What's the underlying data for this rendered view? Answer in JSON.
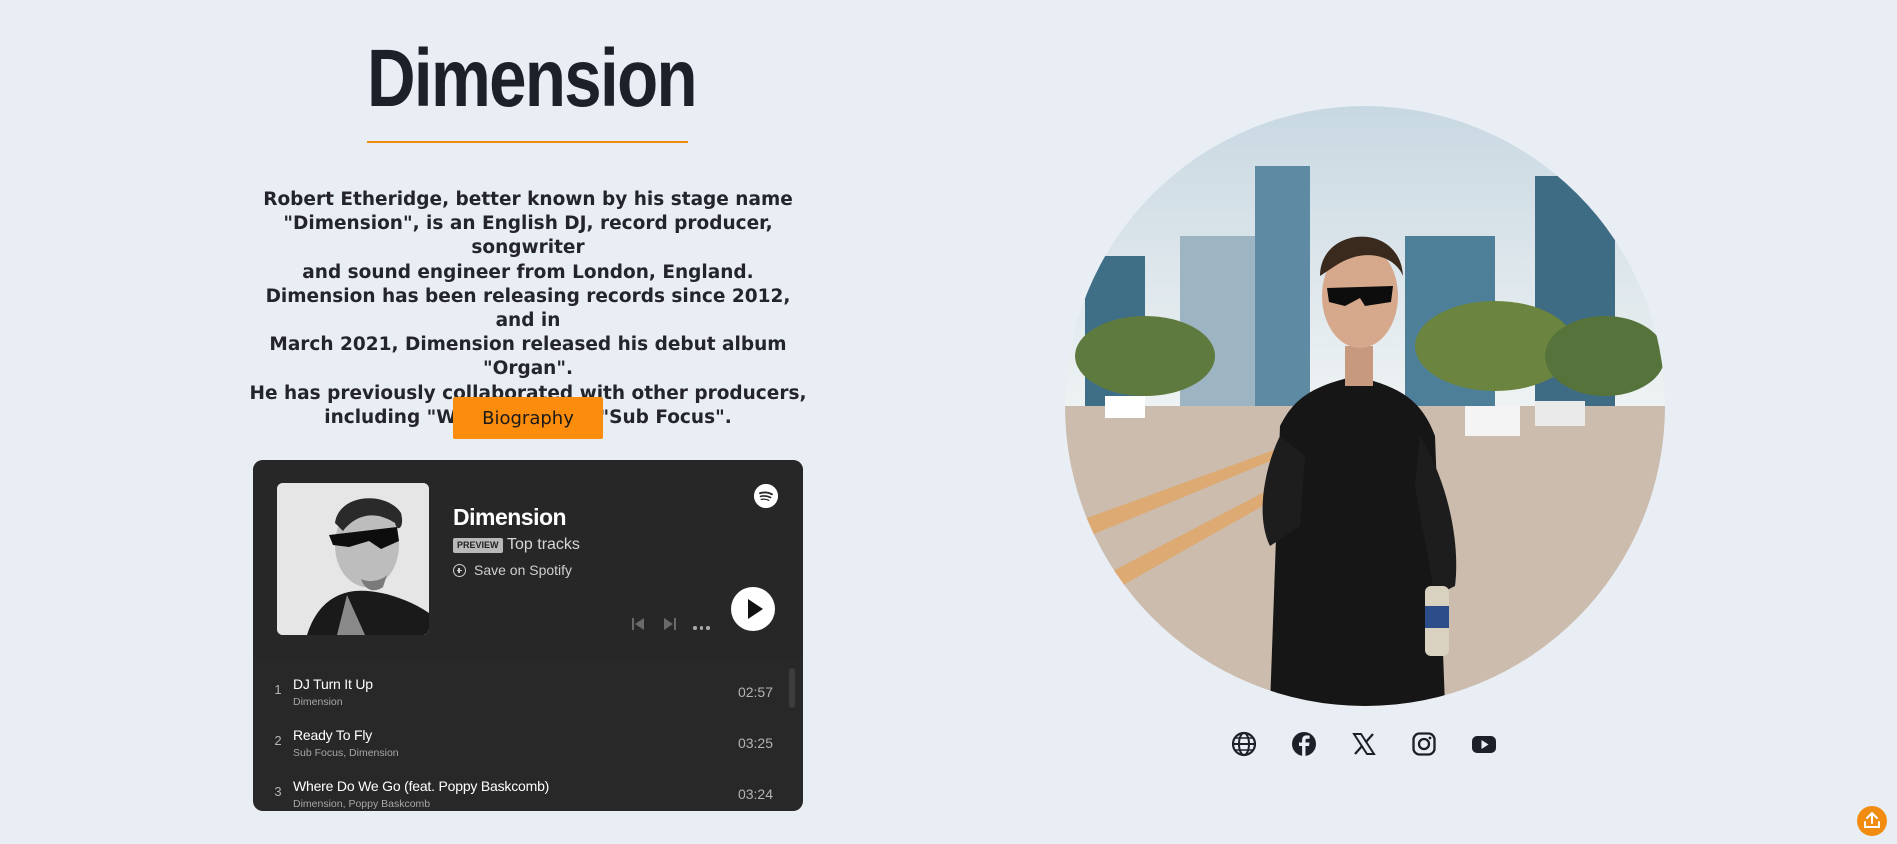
{
  "artist": {
    "name": "Dimension",
    "bio_lines": [
      "Robert Etheridge, better known by his stage name",
      "\"Dimension\", is an English DJ, record producer, songwriter",
      "and sound engineer from London, England.",
      "Dimension has been releasing records since 2012, and in",
      "March 2021, Dimension released his debut album \"Organ\".",
      "He has previously collaborated with other producers,",
      "including \"Wilkinson\" and \"Sub Focus\"."
    ],
    "biography_button": "Biography"
  },
  "spotify": {
    "title": "Dimension",
    "badge": "PREVIEW",
    "subtitle": "Top tracks",
    "save_label": "Save on Spotify",
    "tracks": [
      {
        "num": "1",
        "name": "DJ Turn It Up",
        "artists": "Dimension",
        "duration": "02:57"
      },
      {
        "num": "2",
        "name": "Ready To Fly",
        "artists": "Sub Focus, Dimension",
        "duration": "03:25"
      },
      {
        "num": "3",
        "name": "Where Do We Go (feat. Poppy Baskcomb)",
        "artists": "Dimension, Poppy Baskcomb",
        "duration": "03:24"
      }
    ]
  },
  "socials": [
    "globe-icon",
    "facebook-icon",
    "x-icon",
    "instagram-icon",
    "youtube-icon"
  ],
  "colors": {
    "accent": "#fb8c0c",
    "background": "#e9eef4",
    "embed_bg": "#282828"
  }
}
